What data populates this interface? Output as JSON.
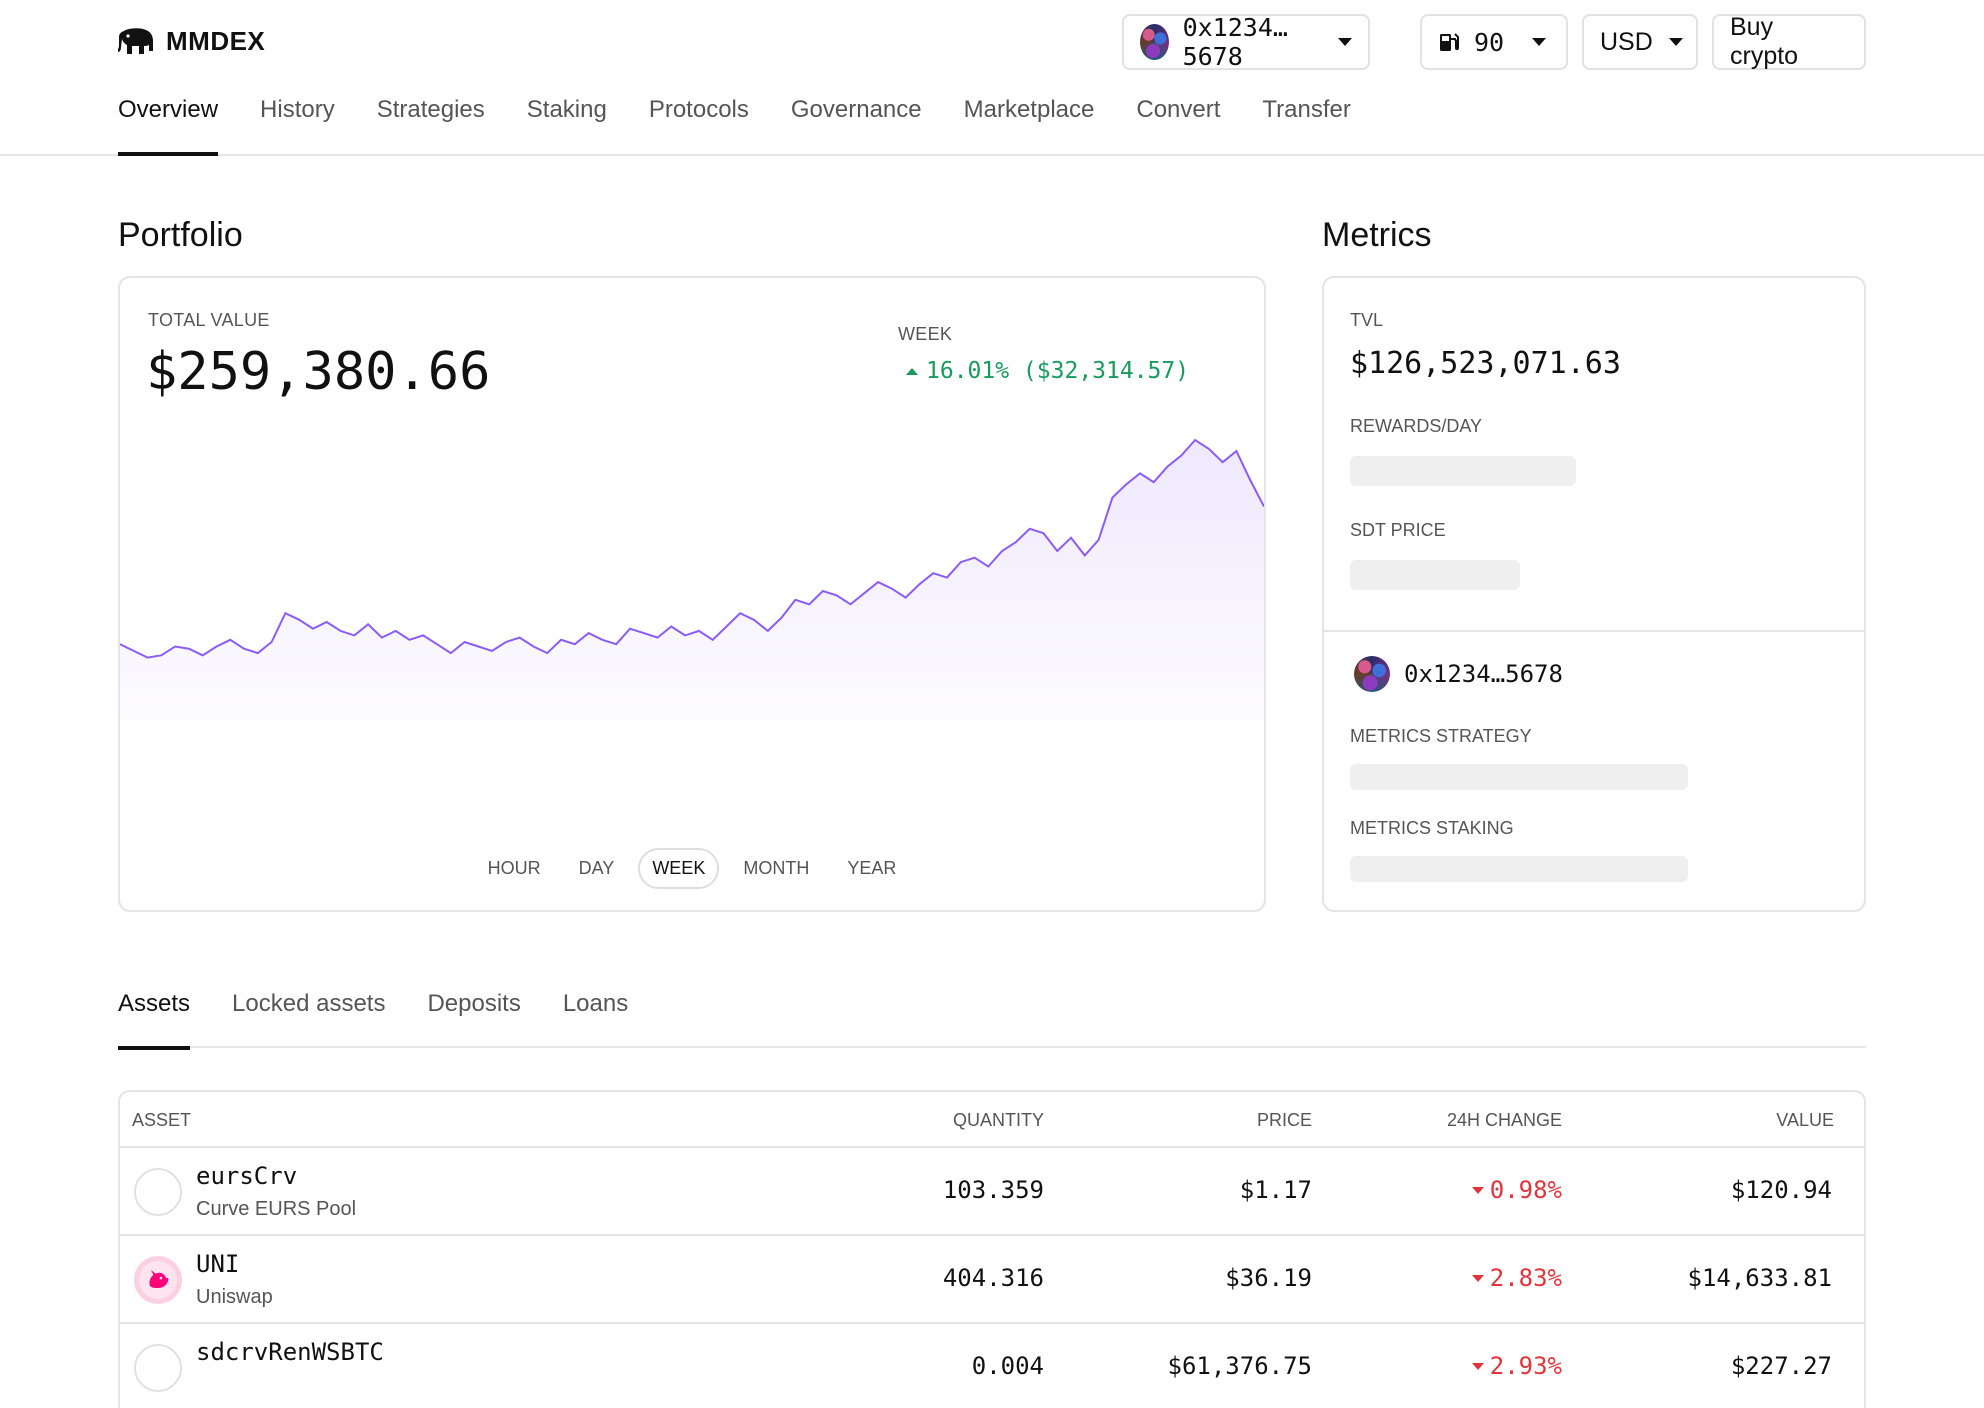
{
  "header": {
    "logo_text": "MMDEX",
    "wallet_label": "0x1234…5678",
    "gas_value": "90",
    "currency": "USD",
    "buy_label": "Buy crypto"
  },
  "nav": [
    "Overview",
    "History",
    "Strategies",
    "Staking",
    "Protocols",
    "Governance",
    "Marketplace",
    "Convert",
    "Transfer"
  ],
  "portfolio": {
    "title": "Portfolio",
    "total_label": "TOTAL VALUE",
    "total_value": "$259,380.66",
    "period_label": "WEEK",
    "change": "16.01% ($32,314.57)",
    "ranges": [
      "HOUR",
      "DAY",
      "WEEK",
      "MONTH",
      "YEAR"
    ],
    "active_range": "WEEK"
  },
  "metrics": {
    "title": "Metrics",
    "tvl_label": "TVL",
    "tvl_value": "$126,523,071.63",
    "rewards_label": "REWARDS/DAY",
    "sdt_label": "SDT PRICE",
    "wallet": "0x1234…5678",
    "strategy_label": "METRICS STRATEGY",
    "staking_label": "METRICS STAKING"
  },
  "tabs": [
    "Assets",
    "Locked assets",
    "Deposits",
    "Loans"
  ],
  "table": {
    "headers": {
      "asset": "ASSET",
      "quantity": "QUANTITY",
      "price": "PRICE",
      "change": "24H CHANGE",
      "value": "VALUE"
    },
    "rows": [
      {
        "name": "eursCrv",
        "sub": "Curve EURS Pool",
        "quantity": "103.359",
        "price": "$1.17",
        "change": "0.98%",
        "value": "$120.94"
      },
      {
        "name": "UNI",
        "sub": "Uniswap",
        "quantity": "404.316",
        "price": "$36.19",
        "change": "2.83%",
        "value": "$14,633.81"
      },
      {
        "name": "sdcrvRenWSBTC",
        "sub": "",
        "quantity": "0.004",
        "price": "$61,376.75",
        "change": "2.93%",
        "value": "$227.27"
      }
    ]
  },
  "colors": {
    "accent_line": "#8b5cf6",
    "positive": "#1a9b5e",
    "negative": "#e0353b"
  },
  "chart_data": {
    "type": "area",
    "title": "",
    "xlabel": "",
    "ylabel": "",
    "values": [
      0.08,
      0.05,
      0.02,
      0.03,
      0.07,
      0.06,
      0.03,
      0.07,
      0.1,
      0.06,
      0.04,
      0.09,
      0.22,
      0.19,
      0.15,
      0.18,
      0.14,
      0.12,
      0.17,
      0.11,
      0.14,
      0.1,
      0.12,
      0.08,
      0.04,
      0.09,
      0.07,
      0.05,
      0.09,
      0.11,
      0.07,
      0.04,
      0.1,
      0.08,
      0.13,
      0.1,
      0.08,
      0.15,
      0.13,
      0.11,
      0.16,
      0.12,
      0.14,
      0.1,
      0.16,
      0.22,
      0.19,
      0.14,
      0.2,
      0.28,
      0.26,
      0.32,
      0.3,
      0.26,
      0.31,
      0.36,
      0.33,
      0.29,
      0.35,
      0.4,
      0.38,
      0.45,
      0.47,
      0.43,
      0.5,
      0.54,
      0.6,
      0.58,
      0.5,
      0.56,
      0.48,
      0.55,
      0.74,
      0.8,
      0.85,
      0.81,
      0.88,
      0.93,
      1.0,
      0.96,
      0.9,
      0.95,
      0.82,
      0.7
    ],
    "ylim": [
      0,
      1
    ]
  }
}
